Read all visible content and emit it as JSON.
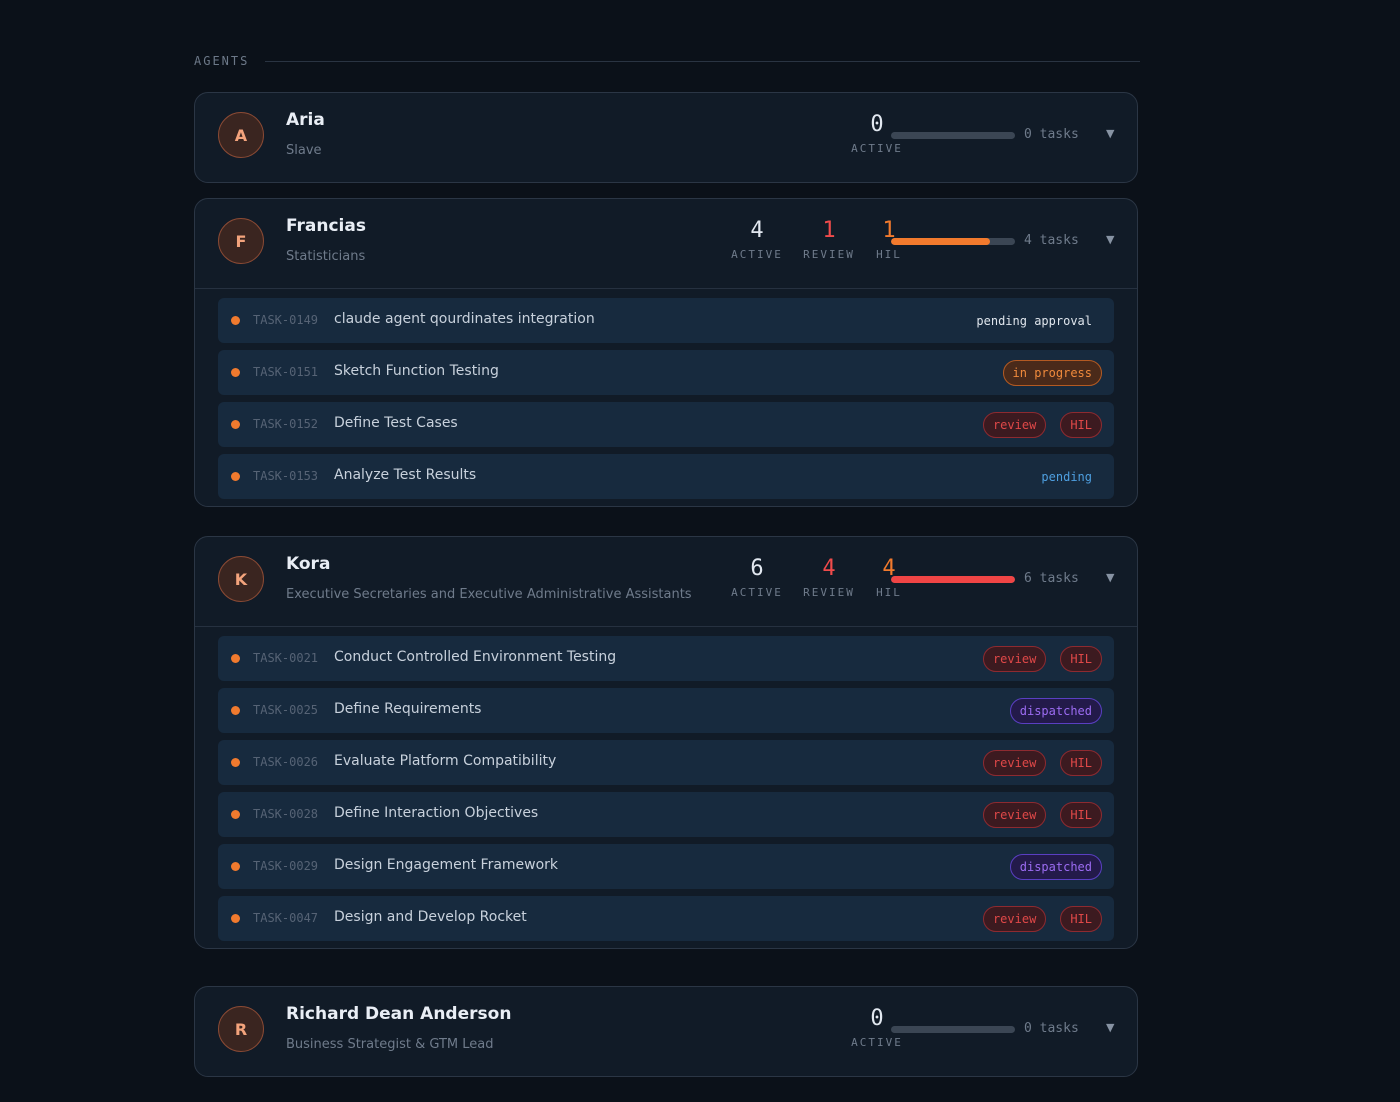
{
  "section": {
    "title": "AGENTS"
  },
  "colors": {
    "accent": "#f27a2d",
    "danger": "#f04b4b",
    "progress_track": "#3b4654"
  },
  "agents": [
    {
      "initial": "A",
      "name": "Aria",
      "role": "Slave",
      "stats": [
        {
          "value": "0",
          "label": "ACTIVE",
          "tone": "white"
        }
      ],
      "progress_fraction": 0,
      "progress_color": "#f27a2d",
      "tasks_label": "0 tasks",
      "chevron": "▼",
      "tasks": []
    },
    {
      "initial": "F",
      "name": "Francias",
      "role": "Statisticians",
      "stats": [
        {
          "value": "4",
          "label": "ACTIVE",
          "tone": "white"
        },
        {
          "value": "1",
          "label": "REVIEW",
          "tone": "red"
        },
        {
          "value": "1",
          "label": "HIL",
          "tone": "orange"
        }
      ],
      "progress_fraction": 0.8,
      "progress_color": "#f27a2d",
      "tasks_label": "4 tasks",
      "chevron": "▼",
      "tasks": [
        {
          "id": "TASK-0149",
          "title": "claude agent qourdinates integration",
          "badges": [
            {
              "text": "pending approval",
              "kind": "plain"
            }
          ]
        },
        {
          "id": "TASK-0151",
          "title": "Sketch Function Testing",
          "badges": [
            {
              "text": "in progress",
              "kind": "progress"
            }
          ]
        },
        {
          "id": "TASK-0152",
          "title": "Define Test Cases",
          "badges": [
            {
              "text": "review",
              "kind": "review"
            },
            {
              "text": "HIL",
              "kind": "hil"
            }
          ]
        },
        {
          "id": "TASK-0153",
          "title": "Analyze Test Results",
          "badges": [
            {
              "text": "pending",
              "kind": "pending"
            }
          ]
        }
      ]
    },
    {
      "initial": "K",
      "name": "Kora",
      "role": "Executive Secretaries and Executive Administrative Assistants",
      "stats": [
        {
          "value": "6",
          "label": "ACTIVE",
          "tone": "white"
        },
        {
          "value": "4",
          "label": "REVIEW",
          "tone": "red"
        },
        {
          "value": "4",
          "label": "HIL",
          "tone": "orange"
        }
      ],
      "progress_fraction": 1.0,
      "progress_color": "#f04545",
      "tasks_label": "6 tasks",
      "chevron": "▼",
      "tasks": [
        {
          "id": "TASK-0021",
          "title": "Conduct Controlled Environment Testing",
          "badges": [
            {
              "text": "review",
              "kind": "review"
            },
            {
              "text": "HIL",
              "kind": "hil"
            }
          ]
        },
        {
          "id": "TASK-0025",
          "title": "Define Requirements",
          "badges": [
            {
              "text": "dispatched",
              "kind": "dispatched"
            }
          ]
        },
        {
          "id": "TASK-0026",
          "title": "Evaluate Platform Compatibility",
          "badges": [
            {
              "text": "review",
              "kind": "review"
            },
            {
              "text": "HIL",
              "kind": "hil"
            }
          ]
        },
        {
          "id": "TASK-0028",
          "title": "Define Interaction Objectives",
          "badges": [
            {
              "text": "review",
              "kind": "review"
            },
            {
              "text": "HIL",
              "kind": "hil"
            }
          ]
        },
        {
          "id": "TASK-0029",
          "title": "Design Engagement Framework",
          "badges": [
            {
              "text": "dispatched",
              "kind": "dispatched"
            }
          ]
        },
        {
          "id": "TASK-0047",
          "title": "Design and Develop Rocket",
          "badges": [
            {
              "text": "review",
              "kind": "review"
            },
            {
              "text": "HIL",
              "kind": "hil"
            }
          ]
        }
      ]
    },
    {
      "initial": "R",
      "name": "Richard Dean Anderson",
      "role": "Business Strategist & GTM Lead",
      "stats": [
        {
          "value": "0",
          "label": "ACTIVE",
          "tone": "white"
        }
      ],
      "progress_fraction": 0,
      "progress_color": "#f27a2d",
      "tasks_label": "0 tasks",
      "chevron": "▼",
      "tasks": []
    }
  ]
}
